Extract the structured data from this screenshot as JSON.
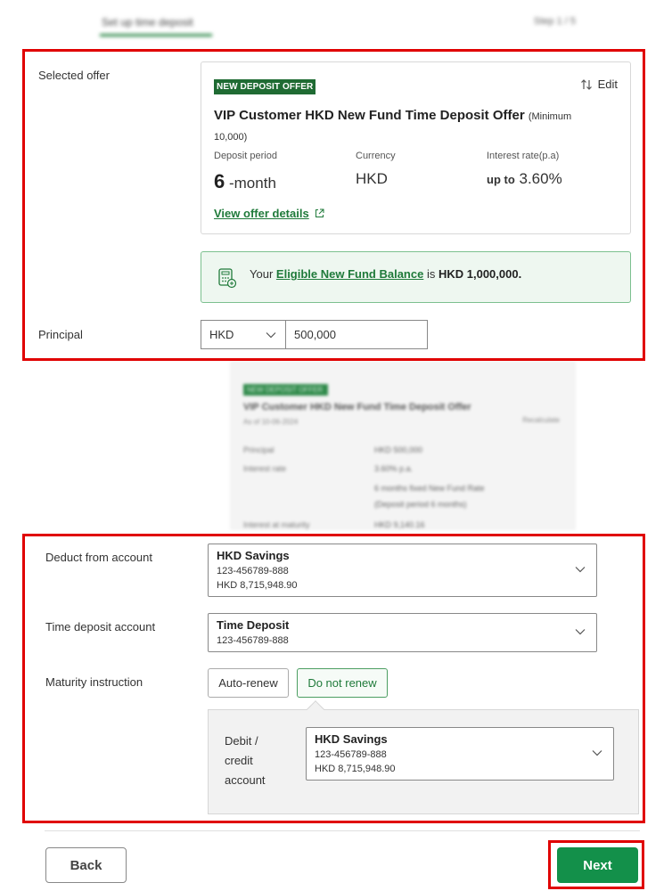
{
  "step": {
    "title": "Set up time deposit",
    "count": "Step 1 / 5"
  },
  "colors": {
    "accent": "#13904a",
    "highlight_box": "#e00000",
    "badge_bg": "#1f6b33"
  },
  "selected_offer": {
    "label": "Selected offer",
    "badge": "NEW DEPOSIT OFFER",
    "edit_label": "Edit",
    "title": "VIP Customer HKD New Fund Time Deposit Offer",
    "minimum": "(Minimum 10,000)",
    "deposit_period_label": "Deposit period",
    "deposit_period_value": "6",
    "deposit_period_unit": "-month",
    "currency_label": "Currency",
    "currency_value": "HKD",
    "interest_label": "Interest rate(p.a)",
    "interest_prefix": "up to",
    "interest_value": "3.60%",
    "view_details": "View offer details"
  },
  "eligible": {
    "prefix": "Your",
    "link": "Eligible New Fund Balance",
    "middle": "is",
    "amount": "HKD 1,000,000",
    "suffix": "."
  },
  "principal": {
    "label": "Principal",
    "currency": "HKD",
    "amount": "500,000"
  },
  "summary": {
    "badge": "NEW DEPOSIT OFFER",
    "title": "VIP Customer HKD New Fund Time Deposit Offer",
    "subtitle": "As of 10-06-2024",
    "note": "Recalculate",
    "rows": [
      {
        "label": "Principal",
        "value": "HKD 500,000"
      },
      {
        "label": "Interest rate",
        "value": "3.60% p.a."
      },
      {
        "label": "",
        "value": "6 months fixed New Fund Rate"
      },
      {
        "label": "",
        "value": "(Deposit period 6 months)"
      },
      {
        "label": "Interest at maturity",
        "value": "HKD 9,140.16"
      }
    ]
  },
  "deduct": {
    "label": "Deduct from account",
    "name": "HKD Savings",
    "number": "123-456789-888",
    "balance": "HKD 8,715,948.90"
  },
  "td_account": {
    "label": "Time deposit account",
    "name": "Time Deposit",
    "number": "123-456789-888"
  },
  "maturity": {
    "label": "Maturity instruction",
    "options": [
      "Auto-renew",
      "Do not renew"
    ],
    "selected": "Do not renew",
    "debit_label": "Debit / credit account",
    "account_name": "HKD Savings",
    "account_number": "123-456789-888",
    "account_balance": "HKD 8,715,948.90"
  },
  "footer": {
    "back": "Back",
    "next": "Next"
  }
}
